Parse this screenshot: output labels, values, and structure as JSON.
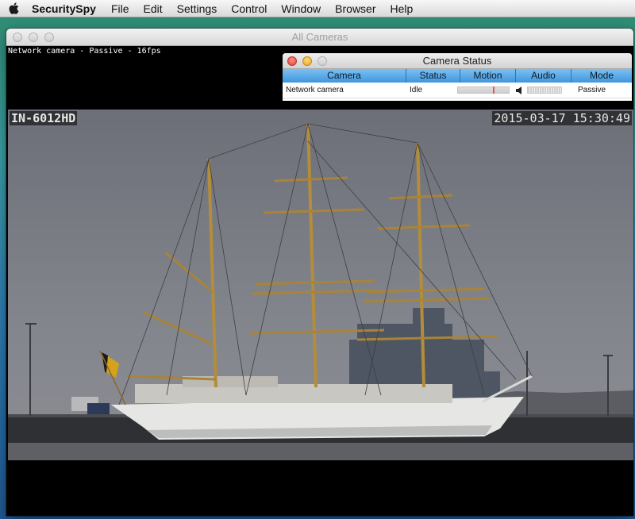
{
  "menubar": {
    "apple_icon": "apple-icon",
    "app_name": "SecuritySpy",
    "items": [
      "File",
      "Edit",
      "Settings",
      "Control",
      "Window",
      "Browser",
      "Help"
    ]
  },
  "window": {
    "title": "All Cameras"
  },
  "camera_view": {
    "caption": "Network camera - Passive - 16fps",
    "overlay_name": "IN-6012HD",
    "overlay_timestamp": "2015-03-17 15:30:49"
  },
  "status_panel": {
    "title": "Camera Status",
    "columns": [
      "Camera",
      "Status",
      "Motion",
      "Audio",
      "Mode"
    ],
    "rows": [
      {
        "camera": "Network camera",
        "status": "Idle",
        "motion_level": 0.68,
        "audio_icon": "speaker-icon",
        "mode": "Passive"
      }
    ]
  },
  "colors": {
    "header_blue": "#4fa3e3",
    "motion_marker": "#e65a4a"
  }
}
